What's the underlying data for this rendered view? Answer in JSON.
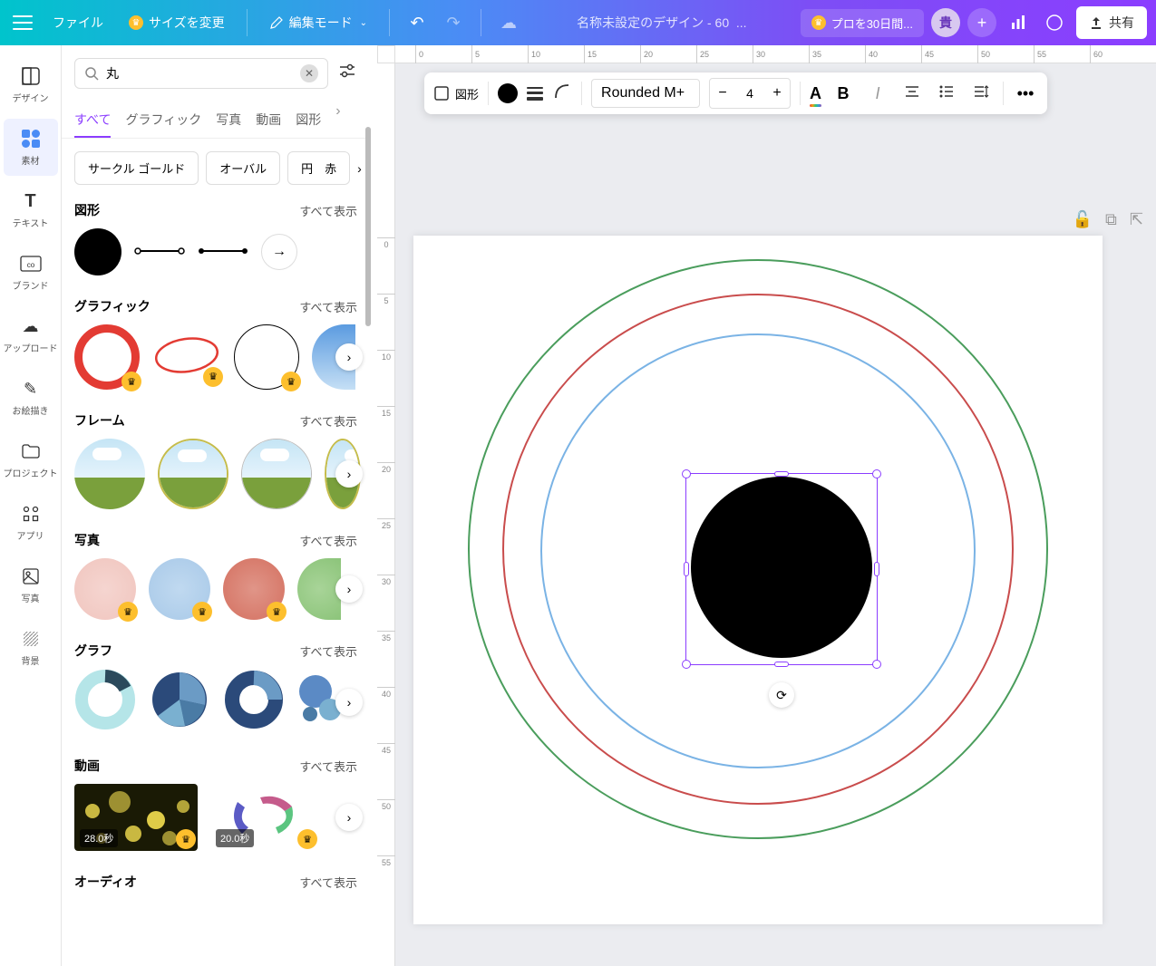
{
  "topbar": {
    "file": "ファイル",
    "resize": "サイズを変更",
    "mode": "編集モード",
    "title": "名称未設定のデザイン - 60",
    "pro": "プロを30日間...",
    "avatar": "貴",
    "share": "共有"
  },
  "rail": [
    {
      "key": "design",
      "label": "デザイン"
    },
    {
      "key": "elements",
      "label": "素材"
    },
    {
      "key": "text",
      "label": "テキスト"
    },
    {
      "key": "brand",
      "label": "ブランド"
    },
    {
      "key": "upload",
      "label": "アップロード"
    },
    {
      "key": "draw",
      "label": "お絵描き"
    },
    {
      "key": "projects",
      "label": "プロジェクト"
    },
    {
      "key": "apps",
      "label": "アプリ"
    },
    {
      "key": "photos",
      "label": "写真"
    },
    {
      "key": "bg",
      "label": "背景"
    }
  ],
  "search": {
    "value": "丸"
  },
  "tabs": [
    "すべて",
    "グラフィック",
    "写真",
    "動画",
    "図形"
  ],
  "chips": [
    "サークル ゴールド",
    "オーバル",
    "円　赤"
  ],
  "see_all": "すべて表示",
  "sections": {
    "shapes": "図形",
    "graphics": "グラフィック",
    "frames": "フレーム",
    "photos": "写真",
    "graphs": "グラフ",
    "videos": "動画",
    "audio": "オーディオ"
  },
  "videos": {
    "d1": "28.0秒",
    "d2": "20.0秒"
  },
  "toolbar": {
    "shape": "図形",
    "font": "Rounded M+",
    "size": "4"
  },
  "ruler_h": [
    "0",
    "5",
    "10",
    "15",
    "20",
    "25",
    "30",
    "35",
    "40",
    "45",
    "50",
    "55",
    "60"
  ],
  "ruler_v": [
    "0",
    "5",
    "10",
    "15",
    "20",
    "25",
    "30",
    "35",
    "40",
    "45",
    "50",
    "55"
  ]
}
